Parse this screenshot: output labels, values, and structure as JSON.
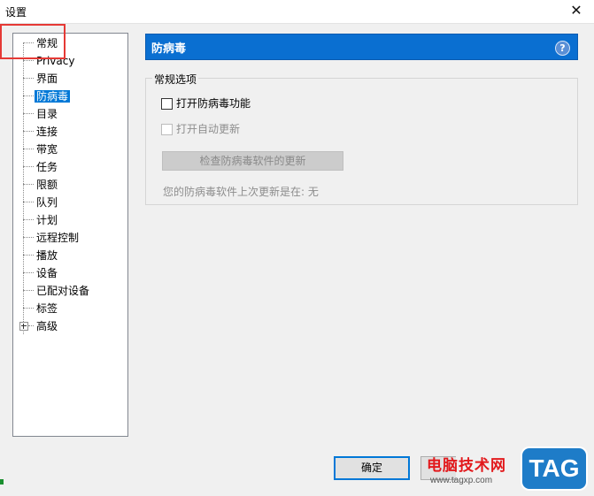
{
  "window": {
    "title": "设置",
    "close_glyph": "✕"
  },
  "tree": {
    "items": [
      {
        "label": "常规"
      },
      {
        "label": "Privacy"
      },
      {
        "label": "界面"
      },
      {
        "label": "防病毒",
        "selected": true
      },
      {
        "label": "目录"
      },
      {
        "label": "连接"
      },
      {
        "label": "带宽"
      },
      {
        "label": "任务"
      },
      {
        "label": "限额"
      },
      {
        "label": "队列"
      },
      {
        "label": "计划"
      },
      {
        "label": "远程控制"
      },
      {
        "label": "播放"
      },
      {
        "label": "设备"
      },
      {
        "label": "已配对设备"
      },
      {
        "label": "标签"
      },
      {
        "label": "高级",
        "expandable": true
      }
    ]
  },
  "panel": {
    "title": "防病毒",
    "help_glyph": "?",
    "group_title": "常规选项",
    "enable_antivirus": {
      "label": "打开防病毒功能",
      "checked": false
    },
    "auto_update": {
      "label": "打开自动更新",
      "checked": false,
      "disabled": true
    },
    "check_updates_button": "检查防病毒软件的更新",
    "last_update_text": "您的防病毒软件上次更新是在:   无"
  },
  "buttons": {
    "ok": "确定"
  },
  "watermark": {
    "brand": "电脑技术网",
    "url": "www.tagxp.com",
    "logo": "TAG"
  },
  "colors": {
    "header_bg": "#0a6fd1",
    "selection": "#0078d7",
    "annotation": "#e53935"
  }
}
